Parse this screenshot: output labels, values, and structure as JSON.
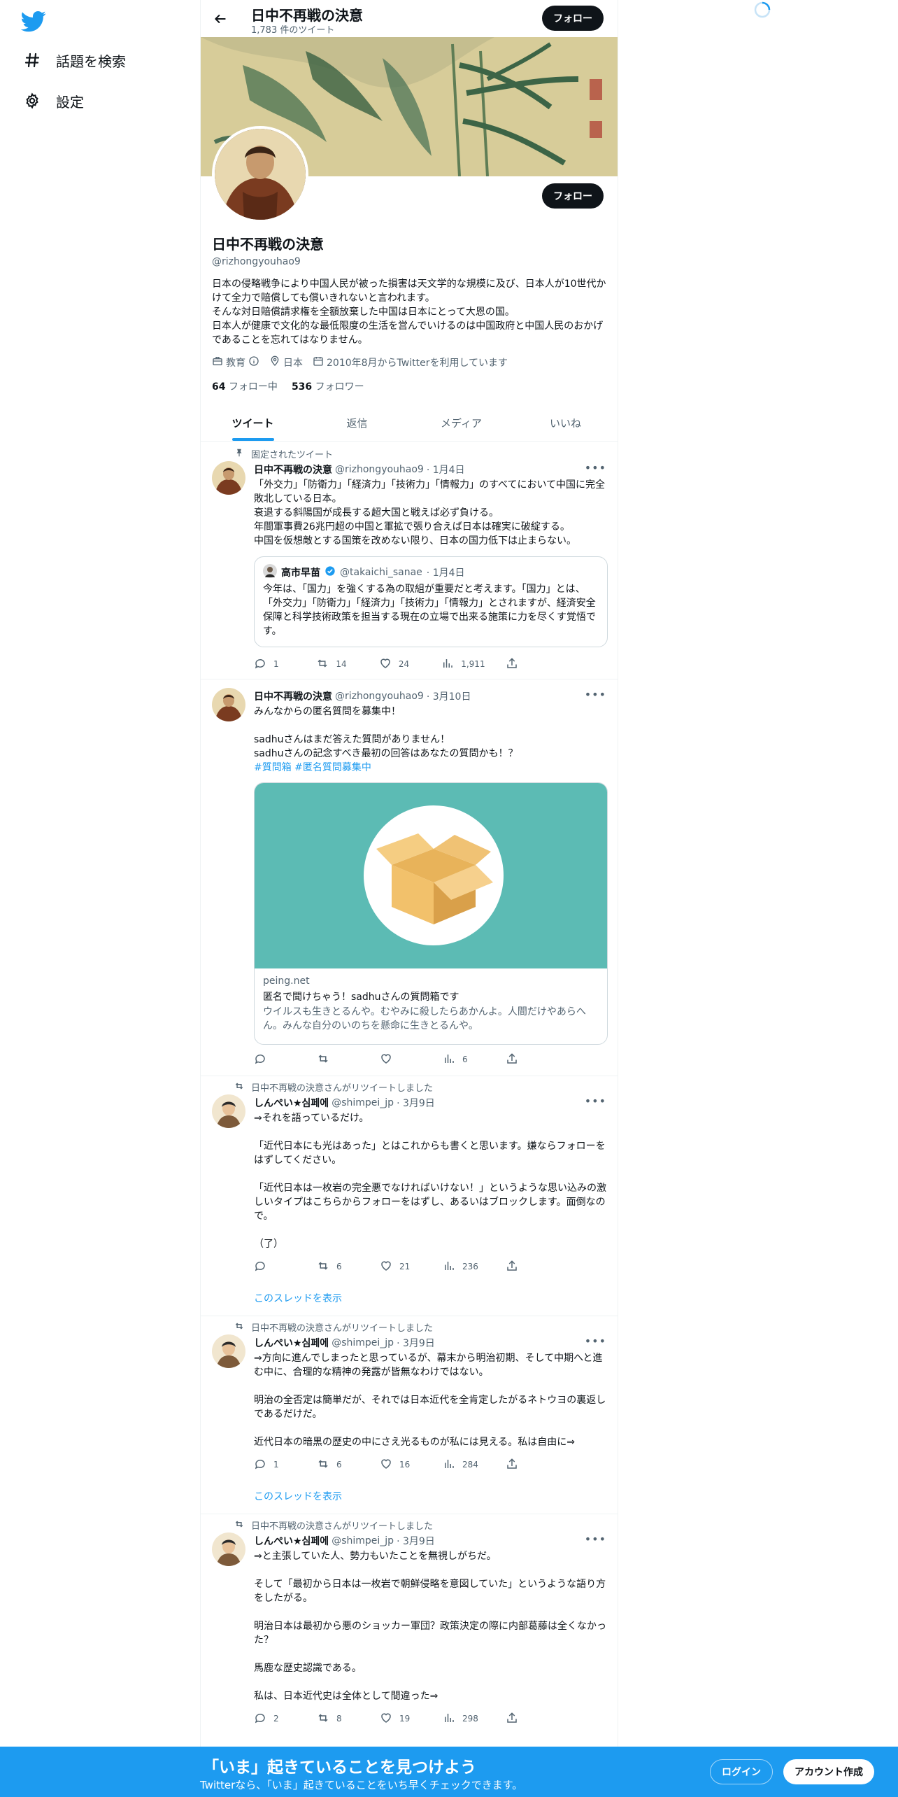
{
  "colors": {
    "accent": "#1d9bf0",
    "text": "#0f1419",
    "muted": "#536471",
    "button_dark": "#0f1419"
  },
  "nav": {
    "logo": "twitter-bird-icon",
    "items": [
      {
        "label": "話題を検索",
        "icon": "hashtag-icon"
      },
      {
        "label": "設定",
        "icon": "gear-icon"
      }
    ]
  },
  "header": {
    "title": "日中不再戦の決意",
    "tweet_count": "1,783 件のツイート",
    "follow_label": "フォロー"
  },
  "profile": {
    "name": "日中不再戦の決意",
    "handle": "@rizhongyouhao9",
    "follow_label": "フォロー",
    "bio": "日本の侵略戦争により中国人民が被った損害は天文学的な規模に及び、日本人が10世代かけて全力で賠償しても償いきれないと言われます。\nそんな対日賠償請求権を全額放棄した中国は日本にとって大恩の国。\n日本人が健康で文化的な最低限度の生活を営んでいけるのは中国政府と中国人民のおかげであることを忘れてはなりません。",
    "category": "教育",
    "location": "日本",
    "joined": "2010年8月からTwitterを利用しています",
    "following_count": "64",
    "following_label": "フォロー中",
    "followers_count": "536",
    "followers_label": "フォロワー"
  },
  "tabs": [
    "ツイート",
    "返信",
    "メディア",
    "いいね"
  ],
  "tweets": [
    {
      "context": "固定されたツイート",
      "name": "日中不再戦の決意",
      "handle": "@rizhongyouhao9",
      "time": "· 1月4日",
      "text": "「外交力」「防衛力」「経済力」「技術力」「情報力」のすべてにおいて中国に完全敗北している日本。\n衰退する斜陽国が成長する超大国と戦えば必ず負ける。\n年間軍事費26兆円超の中国と軍拡で張り合えば日本は確実に破綻する。\n中国を仮想敵とする国策を改めない限り、日本の国力低下は止まらない。",
      "quote": {
        "name": "高市早苗",
        "handle": "@takaichi_sanae",
        "time": "· 1月4日",
        "text": "今年は、「国力」を強くする為の取組が重要だと考えます。「国力」とは、「外交力」「防衛力」「経済力」「技術力」「情報力」とされますが、経済安全保障と科学技術政策を担当する現在の立場で出来る施策に力を尽くす覚悟です。"
      },
      "replies": "1",
      "retweets": "14",
      "likes": "24",
      "views": "1,911"
    },
    {
      "name": "日中不再戦の決意",
      "handle": "@rizhongyouhao9",
      "time": "· 3月10日",
      "text": "みんなからの匿名質問を募集中！\n\nsadhuさんはまだ答えた質問がありません！\nsadhuさんの記念すべき最初の回答はあなたの質問かも！？",
      "hashtags": "#質問箱 #匿名質問募集中",
      "card": {
        "domain": "peing.net",
        "title": "匿名で聞けちゃう！sadhuさんの質問箱です",
        "desc": "ウイルスも生きとるんや。むやみに殺したらあかんよ。人間だけやあらへん。みんな自分のいのちを懸命に生きとるんや。",
        "icon": "cardboard-box-icon"
      },
      "replies": "",
      "retweets": "",
      "likes": "",
      "views": "6"
    },
    {
      "context": "日中不再戦の決意さんがリツイートしました",
      "name": "しんぺい★심페에",
      "handle": "@shimpei_jp",
      "time": "· 3月9日",
      "text": "⇒それを語っているだけ。\n\n「近代日本にも光はあった」とはこれからも書くと思います。嫌ならフォローをはずしてください。\n\n「近代日本は一枚岩の完全悪でなければいけない！」というような思い込みの激しいタイプはこちらからフォローをはずし、あるいはブロックします。面倒なので。\n\n（了）",
      "replies": "",
      "retweets": "6",
      "likes": "21",
      "views": "236",
      "thread_label": "このスレッドを表示"
    },
    {
      "context": "日中不再戦の決意さんがリツイートしました",
      "name": "しんぺい★심페에",
      "handle": "@shimpei_jp",
      "time": "· 3月9日",
      "text": "⇒方向に進んでしまったと思っているが、幕末から明治初期、そして中期へと進む中に、合理的な精神の発露が皆無なわけではない。\n\n明治の全否定は簡単だが、それでは日本近代を全肯定したがるネトウヨの裏返しであるだけだ。\n\n近代日本の暗黒の歴史の中にさえ光るものが私には見える。私は自由に⇒",
      "replies": "1",
      "retweets": "6",
      "likes": "16",
      "views": "284",
      "thread_label": "このスレッドを表示"
    },
    {
      "context": "日中不再戦の決意さんがリツイートしました",
      "name": "しんぺい★심페에",
      "handle": "@shimpei_jp",
      "time": "· 3月9日",
      "text": "⇒と主張していた人、勢力もいたことを無視しがちだ。\n\nそして「最初から日本は一枚岩で朝鮮侵略を意図していた」というような語り方をしたがる。\n\n明治日本は最初から悪のショッカー軍団？政策決定の際に内部葛藤は全くなかった？\n\n馬鹿な歴史認識である。\n\n私は、日本近代史は全体として間違った⇒",
      "replies": "2",
      "retweets": "8",
      "likes": "19",
      "views": "298"
    }
  ],
  "bottom_bar": {
    "title": "「いま」起きていることを見つけよう",
    "subtitle": "Twitterなら、「いま」起きていることをいち早くチェックできます。",
    "login_label": "ログイン",
    "signup_label": "アカウント作成"
  }
}
